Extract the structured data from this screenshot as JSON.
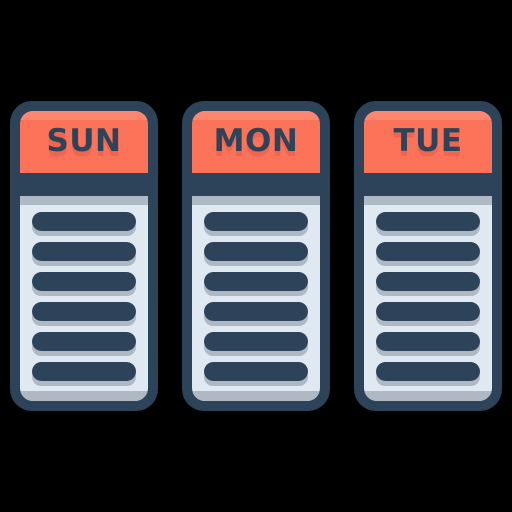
{
  "icon": {
    "name": "weekly-calendar-days-icon",
    "cards": [
      {
        "day_label": "SUN",
        "line_count": 6,
        "lines": [
          "line-1",
          "line-2",
          "line-3",
          "line-4",
          "line-5",
          "line-6"
        ]
      },
      {
        "day_label": "MON",
        "line_count": 6,
        "lines": [
          "line-1",
          "line-2",
          "line-3",
          "line-4",
          "line-5",
          "line-6"
        ]
      },
      {
        "day_label": "TUE",
        "line_count": 6,
        "lines": [
          "line-1",
          "line-2",
          "line-3",
          "line-4",
          "line-5",
          "line-6"
        ]
      }
    ],
    "colors": {
      "background": "#000000",
      "frame_navy": "#2d435a",
      "header_orange": "#fd7359",
      "header_orange_highlight": "#fe8670",
      "header_text_shadow": "#ef6550",
      "sheet_light": "#e0e8f1",
      "sheet_grey": "#aeb9c4",
      "line_dark": "#2d435a"
    }
  }
}
